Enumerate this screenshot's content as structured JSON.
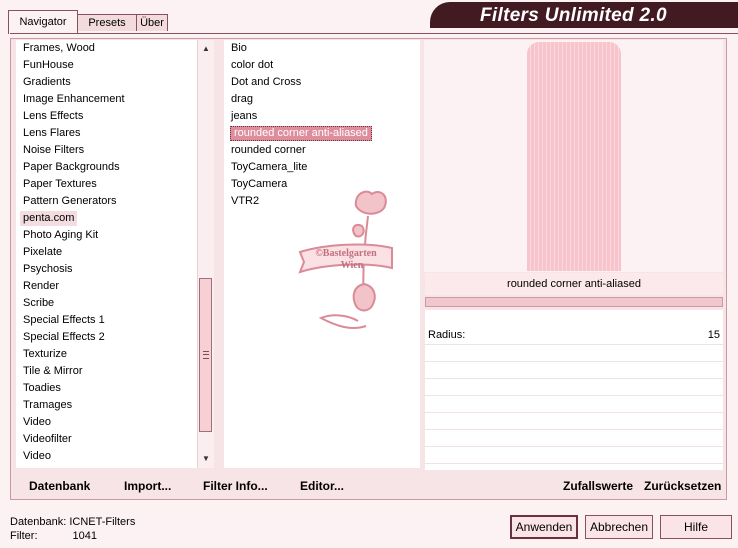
{
  "tabs": {
    "navigator": "Navigator",
    "presets": "Presets",
    "about": "Über"
  },
  "title": "Filters Unlimited 2.0",
  "categories": [
    "Frames, Wood",
    "FunHouse",
    "Gradients",
    "Image Enhancement",
    "Lens Effects",
    "Lens Flares",
    "Noise Filters",
    "Paper Backgrounds",
    "Paper Textures",
    "Pattern Generators",
    "penta.com",
    "Photo Aging Kit",
    "Pixelate",
    "Psychosis",
    "Render",
    "Scribe",
    "Special Effects 1",
    "Special Effects 2",
    "Texturize",
    "Tile & Mirror",
    "Toadies",
    "Tramages",
    "Video",
    "Videofilter",
    "Video"
  ],
  "selected_category": "penta.com",
  "filters": [
    "Bio",
    "color dot",
    "Dot and Cross",
    "drag",
    "jeans",
    "rounded corner anti-aliased",
    "rounded corner",
    "ToyCamera_lite",
    "ToyCamera",
    "VTR2"
  ],
  "selected_filter": "rounded corner anti-aliased",
  "preview_name": "rounded corner anti-aliased",
  "params": [
    {
      "label": "Radius:",
      "value": "15"
    }
  ],
  "links": {
    "datenbank": "Datenbank",
    "import": "Import...",
    "filter_info": "Filter Info...",
    "editor": "Editor...",
    "random": "Zufallswerte",
    "reset": "Zurücksetzen"
  },
  "status": {
    "db_label": "Datenbank:",
    "db_value": "ICNET-Filters",
    "filter_label": "Filter:",
    "filter_value": "1041"
  },
  "buttons": {
    "apply": "Anwenden",
    "cancel": "Abbrechen",
    "help": "Hilfe"
  },
  "watermark": {
    "line1": "©Bastelgarten",
    "line2": "Wien"
  },
  "colors": {
    "accent": "#de8d9c",
    "title_bg": "#421a22",
    "background": "#fdf2f3"
  }
}
